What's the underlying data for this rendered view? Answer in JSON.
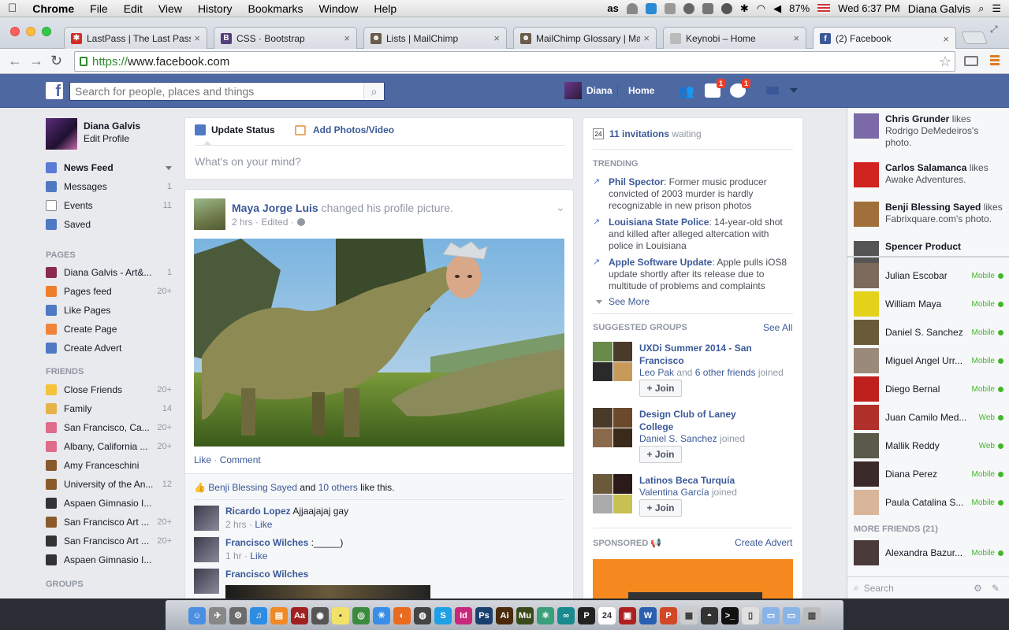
{
  "menubar": {
    "app": "Chrome",
    "items": [
      "File",
      "Edit",
      "View",
      "History",
      "Bookmarks",
      "Window",
      "Help"
    ],
    "battery": "87%",
    "clock": "Wed 6:37 PM",
    "user": "Diana Galvis"
  },
  "tabs": [
    {
      "title": "LastPass | The Last Passw",
      "favicon": "lastpass-icon",
      "color": "#d32d27",
      "glyph": "✱"
    },
    {
      "title": "CSS · Bootstrap",
      "favicon": "bootstrap-icon",
      "color": "#563d7c",
      "glyph": "B"
    },
    {
      "title": "Lists | MailChimp",
      "favicon": "mailchimp-icon",
      "color": "#6b5b4a",
      "glyph": "☻"
    },
    {
      "title": "MailChimp Glossary | Mai",
      "favicon": "mailchimp-icon",
      "color": "#6b5b4a",
      "glyph": "☻"
    },
    {
      "title": "Keynobi – Home",
      "favicon": "page-icon",
      "color": "#bbbbbb",
      "glyph": ""
    },
    {
      "title": "(2) Facebook",
      "favicon": "facebook-icon",
      "color": "#3b5998",
      "glyph": "f"
    }
  ],
  "omnibox": {
    "scheme": "https://",
    "host": "www.facebook.com"
  },
  "fb": {
    "search_placeholder": "Search for people, places and things",
    "profile_name": "Diana",
    "home": "Home",
    "friend_badge": "1",
    "globe_badge": "1"
  },
  "left": {
    "name": "Diana Galvis",
    "edit": "Edit Profile",
    "favorites": [
      {
        "label": "News Feed",
        "count": "",
        "icon": "news-feed-icon",
        "color": "#5b7bd5",
        "bold": true
      },
      {
        "label": "Messages",
        "count": "1",
        "icon": "messages-icon",
        "color": "#4f79c2"
      },
      {
        "label": "Events",
        "count": "11",
        "icon": "events-icon",
        "color": "#ffffff"
      },
      {
        "label": "Saved",
        "count": "",
        "icon": "saved-icon",
        "color": "#4f79c2"
      }
    ],
    "pages_head": "PAGES",
    "pages": [
      {
        "label": "Diana Galvis - Art&...",
        "count": "1",
        "icon": "page-avatar-icon",
        "color": "#8a2b4d"
      },
      {
        "label": "Pages feed",
        "count": "20+",
        "icon": "flag-icon",
        "color": "#ef7e2b"
      },
      {
        "label": "Like Pages",
        "count": "",
        "icon": "like-icon",
        "color": "#4f79c2"
      },
      {
        "label": "Create Page",
        "count": "",
        "icon": "plus-icon",
        "color": "#f0843b"
      },
      {
        "label": "Create Advert",
        "count": "",
        "icon": "chart-icon",
        "color": "#4f79c2"
      }
    ],
    "friends_head": "FRIENDS",
    "friends": [
      {
        "label": "Close Friends",
        "count": "20+",
        "icon": "star-icon",
        "color": "#f5c33b"
      },
      {
        "label": "Family",
        "count": "14",
        "icon": "house-icon",
        "color": "#e6b34a"
      },
      {
        "label": "San Francisco, Ca...",
        "count": "20+",
        "icon": "pin-icon",
        "color": "#e06b8a"
      },
      {
        "label": "Albany, California ...",
        "count": "20+",
        "icon": "pin-icon",
        "color": "#e06b8a"
      },
      {
        "label": "Amy Franceschini",
        "count": "",
        "icon": "briefcase-icon",
        "color": "#8b5a2b"
      },
      {
        "label": "University of the An...",
        "count": "12",
        "icon": "briefcase-icon",
        "color": "#8b5a2b"
      },
      {
        "label": "Aspaen Gimnasio I...",
        "count": "",
        "icon": "graduation-cap-icon",
        "color": "#333333"
      },
      {
        "label": "San Francisco Art ...",
        "count": "20+",
        "icon": "briefcase-icon",
        "color": "#8b5a2b"
      },
      {
        "label": "San Francisco Art ...",
        "count": "20+",
        "icon": "graduation-cap-icon",
        "color": "#333333"
      },
      {
        "label": "Aspaen Gimnasio I...",
        "count": "",
        "icon": "graduation-cap-icon",
        "color": "#333333"
      }
    ],
    "groups_head": "GROUPS"
  },
  "composer": {
    "update": "Update Status",
    "photos": "Add Photos/Video",
    "placeholder": "What's on your mind?"
  },
  "post": {
    "author": "Maya Jorge Luis",
    "action": "changed his profile picture.",
    "meta": "2 hrs · Edited ·",
    "like": "Like",
    "comment": "Comment",
    "likes_name": "Benji Blessing Sayed",
    "likes_and": "and",
    "likes_others": "10 others",
    "likes_tail": "like this.",
    "comments": [
      {
        "author": "Ricardo Lopez",
        "text": "Ajjaajajaj gay",
        "meta": "2 hrs ·",
        "like": "Like"
      },
      {
        "author": "Francisco Wilches",
        "text": ":_____)",
        "meta": "1 hr ·",
        "like": "Like"
      },
      {
        "author": "Francisco Wilches",
        "text": "",
        "meta": "",
        "like": ""
      }
    ]
  },
  "rightcol": {
    "invitations_count": "11 invitations",
    "invitations_tail": "waiting",
    "trending_head": "TRENDING",
    "trending": [
      {
        "topic": "Phil Spector",
        "text": ": Former music producer convicted of 2003 murder is hardly recognizable in new prison photos"
      },
      {
        "topic": "Louisiana State Police",
        "text": ": 14-year-old shot and killed after alleged altercation with police in Louisiana"
      },
      {
        "topic": "Apple Software Update",
        "text": ": Apple pulls iOS8 update shortly after its release due to multitude of problems and complaints"
      }
    ],
    "see_more": "See More",
    "groups_head": "SUGGESTED GROUPS",
    "see_all": "See All",
    "groups": [
      {
        "name": "UXDi Summer 2014 - San Francisco",
        "friends": "Leo Pak",
        "and": "and",
        "others": "6 other friends",
        "tail": "joined",
        "join": "+ Join"
      },
      {
        "name": "Design Club of Laney College",
        "friends": "Daniel S. Sanchez",
        "and": "",
        "others": "",
        "tail": "joined",
        "join": "+ Join"
      },
      {
        "name": "Latinos Beca Turquía",
        "friends": "Valentina García",
        "and": "",
        "others": "",
        "tail": "joined",
        "join": "+ Join"
      }
    ],
    "sponsored": "SPONSORED",
    "create_advert": "Create Advert"
  },
  "ticker": [
    {
      "name": "Chris Grunder",
      "text": " likes Rodrigo DeMedeiros's photo.",
      "color": "#7c6aa8"
    },
    {
      "name": "Carlos Salamanca",
      "text": " likes Awake Adventures.",
      "color": "#d1231f"
    },
    {
      "name": "Benji Blessing Sayed",
      "text": " likes Fabrixquare.com's photo.",
      "color": "#a0703b"
    },
    {
      "name": "Spencer Product",
      "text": "",
      "color": "#555555"
    }
  ],
  "chat": [
    {
      "name": "Julian Escobar",
      "status": "Mobile",
      "color": "#7d6a5a"
    },
    {
      "name": "William Maya",
      "status": "Mobile",
      "color": "#e4d21a"
    },
    {
      "name": "Daniel S. Sanchez",
      "status": "Mobile",
      "color": "#6b5a3a"
    },
    {
      "name": "Miguel Angel Urr...",
      "status": "Mobile",
      "color": "#9a8a7a"
    },
    {
      "name": "Diego Bernal",
      "status": "Mobile",
      "color": "#c0201c"
    },
    {
      "name": "Juan Camilo Med...",
      "status": "Web",
      "color": "#b0302a"
    },
    {
      "name": "Mallik Reddy",
      "status": "Web",
      "color": "#5a5a4a"
    },
    {
      "name": "Diana Perez",
      "status": "Mobile",
      "color": "#3a2a2a"
    },
    {
      "name": "Paula Catalina S...",
      "status": "Mobile",
      "color": "#d9b59a"
    }
  ],
  "more_friends": "MORE FRIENDS (21)",
  "more_chat": [
    {
      "name": "Alexandra Bazur...",
      "status": "Mobile",
      "color": "#4a3a3a"
    }
  ],
  "chat_search": "Search",
  "dock": [
    {
      "icon": "finder-icon",
      "color": "#4b8fe2",
      "glyph": "☺"
    },
    {
      "icon": "launchpad-icon",
      "color": "#888888",
      "glyph": "✈"
    },
    {
      "icon": "system-prefs-icon",
      "color": "#6b6b6b",
      "glyph": "⚙"
    },
    {
      "icon": "itunes-icon",
      "color": "#2e8de2",
      "glyph": "♫"
    },
    {
      "icon": "ibooks-icon",
      "color": "#f08a24",
      "glyph": "▤"
    },
    {
      "icon": "dictionary-icon",
      "color": "#a02020",
      "glyph": "Aa"
    },
    {
      "icon": "photo-booth-icon",
      "color": "#555555",
      "glyph": "◉"
    },
    {
      "icon": "stickies-icon",
      "color": "#f2e26a",
      "glyph": "▪"
    },
    {
      "icon": "chrome-icon",
      "color": "#3b8a3e",
      "glyph": "◎"
    },
    {
      "icon": "safari-icon",
      "color": "#3a8ee6",
      "glyph": "✳"
    },
    {
      "icon": "firefox-icon",
      "color": "#e86b1f",
      "glyph": "◐"
    },
    {
      "icon": "camera-icon",
      "color": "#444444",
      "glyph": "◍"
    },
    {
      "icon": "skype-icon",
      "color": "#1fa0e6",
      "glyph": "S"
    },
    {
      "icon": "indesign-icon",
      "color": "#c8287b",
      "glyph": "Id"
    },
    {
      "icon": "photoshop-icon",
      "color": "#1b3f6e",
      "glyph": "Ps"
    },
    {
      "icon": "illustrator-icon",
      "color": "#4a2a0a",
      "glyph": "Ai"
    },
    {
      "icon": "muse-icon",
      "color": "#3a4a1a",
      "glyph": "Mu"
    },
    {
      "icon": "atom-icon",
      "color": "#3aa07a",
      "glyph": "⚛"
    },
    {
      "icon": "arduino-icon",
      "color": "#1a8a8e",
      "glyph": "∞"
    },
    {
      "icon": "pages-icon",
      "color": "#222222",
      "glyph": "P"
    },
    {
      "icon": "calendar-icon",
      "color": "#ffffff",
      "glyph": "24"
    },
    {
      "icon": "photo-icon",
      "color": "#b02020",
      "glyph": "▣"
    },
    {
      "icon": "word-icon",
      "color": "#2a5fb0",
      "glyph": "W"
    },
    {
      "icon": "powerpoint-icon",
      "color": "#d24726",
      "glyph": "P"
    },
    {
      "icon": "preview-icon",
      "color": "#cccccc",
      "glyph": "▦"
    },
    {
      "icon": "github-icon",
      "color": "#333333",
      "glyph": "◓"
    },
    {
      "icon": "terminal-icon",
      "color": "#111111",
      "glyph": ">_"
    },
    {
      "icon": "document-icon",
      "color": "#e0e0e0",
      "glyph": "▯"
    },
    {
      "icon": "folder-icon",
      "color": "#8ab4e8",
      "glyph": "▭"
    },
    {
      "icon": "downloads-icon",
      "color": "#8ab4e8",
      "glyph": "▭"
    },
    {
      "icon": "trash-icon",
      "color": "#bcbcbc",
      "glyph": "▥"
    }
  ]
}
